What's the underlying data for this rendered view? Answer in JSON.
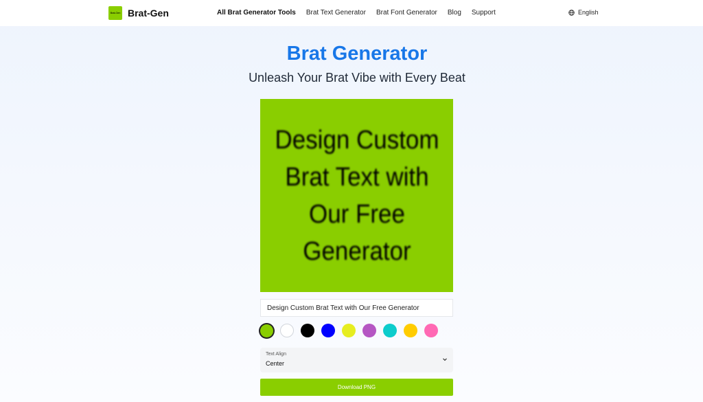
{
  "header": {
    "logo_badge_text": "Brat-Gen",
    "logo_text": "Brat-Gen",
    "nav": [
      {
        "label": "All Brat Generator Tools",
        "active": true
      },
      {
        "label": "Brat Text Generator"
      },
      {
        "label": "Brat Font Generator"
      },
      {
        "label": "Blog"
      },
      {
        "label": "Support"
      }
    ],
    "language": "English"
  },
  "hero": {
    "title": "Brat Generator",
    "subtitle": "Unleash Your Brat Vibe with Every Beat"
  },
  "preview": {
    "text": "Design Custom Brat Text with Our Free Generator",
    "background": "#8ace00"
  },
  "input": {
    "value": "Design Custom Brat Text with Our Free Generator"
  },
  "colors": {
    "selected": "#8ace00",
    "swatches": [
      "#8ace00",
      "#ffffff",
      "#000000",
      "#0000ff",
      "#e6ed20",
      "#b556c3",
      "#0dcccc",
      "#ffcc00",
      "#ff69b4"
    ]
  },
  "text_align": {
    "label": "Text Align",
    "value": "Center"
  },
  "download_label": "Download PNG"
}
